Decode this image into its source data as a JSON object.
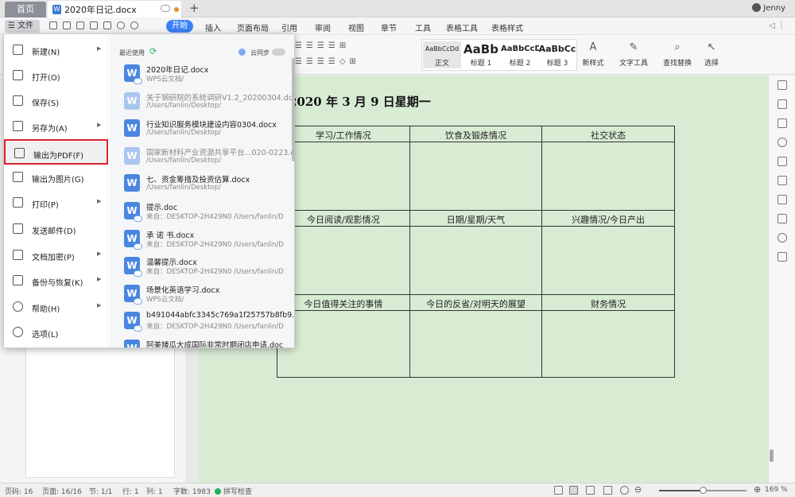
{
  "titlebar": {
    "home_tab": "首页",
    "doc_tab": "2020年日记.docx",
    "add": "+",
    "user": "Jenny"
  },
  "menubar": {
    "file": "☰ 文件",
    "items": [
      "开始",
      "插入",
      "页面布局",
      "引用",
      "审阅",
      "视图",
      "章节",
      "工具",
      "表格工具",
      "表格样式"
    ],
    "right": "◁ ⋮"
  },
  "toolbar": {
    "styles": [
      {
        "sample": "AaBbCcDd",
        "label": "正文"
      },
      {
        "sample": "AaBb",
        "label": "标题 1"
      },
      {
        "sample": "AaBbCcD",
        "label": "标题 2"
      },
      {
        "sample": "AaBbCc",
        "label": "标题 3"
      }
    ],
    "new_style": "新样式",
    "text_tools": "文字工具",
    "find_replace": "查找替换",
    "select": "选择"
  },
  "file_menu": {
    "items": [
      {
        "label": "新建(N)",
        "icon": "new-doc-icon",
        "arrow": "▶"
      },
      {
        "label": "打开(O)",
        "icon": "folder-icon",
        "arrow": ""
      },
      {
        "label": "保存(S)",
        "icon": "save-icon",
        "arrow": ""
      },
      {
        "label": "另存为(A)",
        "icon": "save-as-icon",
        "arrow": "▶"
      },
      {
        "label": "输出为PDF(F)",
        "icon": "pdf-icon",
        "arrow": ""
      },
      {
        "label": "输出为图片(G)",
        "icon": "image-icon",
        "arrow": ""
      },
      {
        "label": "打印(P)",
        "icon": "print-icon",
        "arrow": "▶"
      },
      {
        "label": "发送邮件(D)",
        "icon": "mail-icon",
        "arrow": ""
      },
      {
        "label": "文档加密(P)",
        "icon": "lock-icon",
        "arrow": "▶"
      },
      {
        "label": "备份与恢复(K)",
        "icon": "backup-icon",
        "arrow": "▶"
      },
      {
        "label": "帮助(H)",
        "icon": "help-icon",
        "arrow": "▶"
      },
      {
        "label": "选项(L)",
        "icon": "gear-icon",
        "arrow": ""
      }
    ],
    "recent_header": "最近使用",
    "sync_label": "云同步",
    "recent": [
      {
        "name": "2020年日记.docx",
        "path": "WPS云文档/",
        "dim": false
      },
      {
        "name": "关于钢研院的系统调研V1.2_20200304.docx",
        "path": "/Users/fanlin/Desktop/",
        "dim": true
      },
      {
        "name": "行业知识服务模块建设内容0304.docx",
        "path": "/Users/fanlin/Desktop/",
        "dim": false
      },
      {
        "name": "国家新材料产业资源共享平台...020-0223.doc",
        "path": "/Users/fanlin/Desktop/",
        "dim": true
      },
      {
        "name": "七、资金筹措及投资估算.docx",
        "path": "/Users/fanlin/Desktop/",
        "dim": false
      },
      {
        "name": "提示.doc",
        "path": "来自：DESKTOP-2H429N0 /Users/fanlin/D",
        "dim": false
      },
      {
        "name": "承 诺 书.docx",
        "path": "来自：DESKTOP-2H429N0 /Users/fanlin/D",
        "dim": false
      },
      {
        "name": "温馨提示.docx",
        "path": "来自：DESKTOP-2H429N0 /Users/fanlin/D",
        "dim": false
      },
      {
        "name": "场景化英语学习.docx",
        "path": "WPS云文档/",
        "dim": false
      },
      {
        "name": "b491044abfc3345c769a1f25757b8fb9.do",
        "path": "来自：DESKTOP-2H429N0 /Users/fanlin/D",
        "dim": false
      },
      {
        "name": "阿美矮瓜大成国际非常时期闭店申请.doc",
        "path": "",
        "dim": false
      }
    ]
  },
  "document": {
    "title": "2020 年 3 月 9 日星期一",
    "rows": [
      [
        "学习/工作情况",
        "饮食及锻炼情况",
        "社交状态"
      ],
      [
        "今日阅读/观影情况",
        "日期/星期/天气",
        "兴趣情况/今日产出"
      ],
      [
        "今日值得关注的事情",
        "今日的反省/对明天的展望",
        "财务情况"
      ]
    ]
  },
  "statusbar": {
    "page_code": "页码: 16",
    "pages": "页面: 16/16",
    "section": "节: 1/1",
    "row": "行: 1",
    "col": "列: 1",
    "words": "字数: 1983",
    "spell": "拼写检查",
    "zoom": "169 %",
    "zoom_fraction": 0.5
  }
}
